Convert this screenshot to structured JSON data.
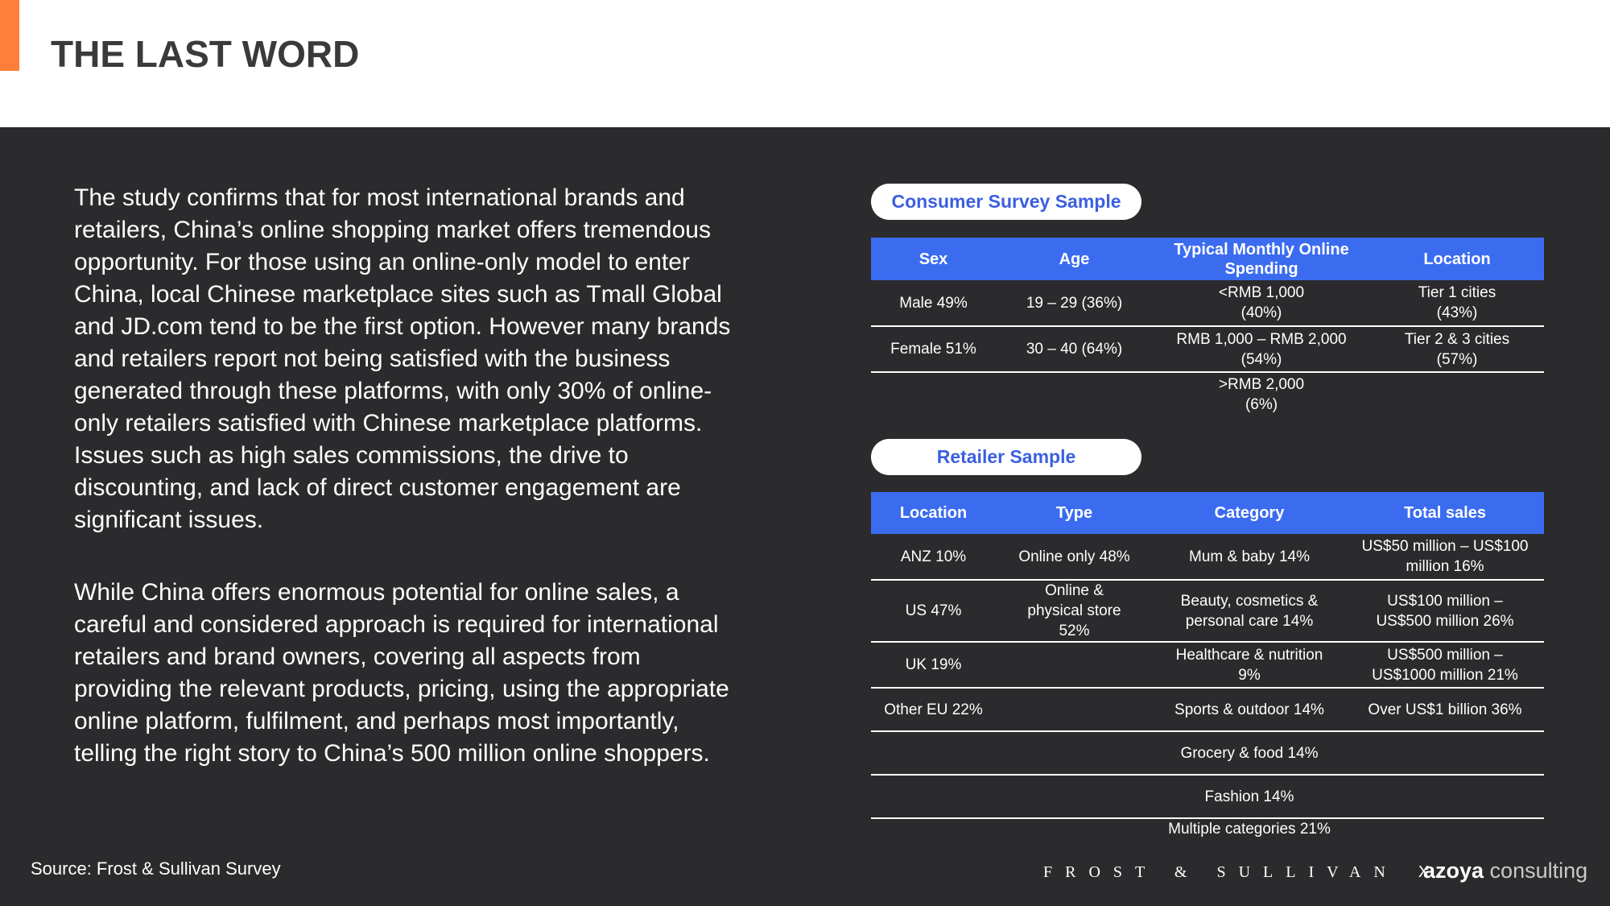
{
  "header": {
    "title": "THE LAST WORD",
    "accent_color": "#ff7f3a"
  },
  "body": {
    "paragraph1": "The study confirms that for most international brands and retailers, China’s online shopping market offers tremendous opportunity. For those using an online-only model to enter China, local Chinese marketplace sites such as Tmall Global and JD.com tend to be the first option. However many brands and retailers report not being satisfied with the business generated through these platforms, with only 30% of online-only retailers satisfied with Chinese marketplace platforms. Issues such as high sales commissions, the drive to discounting, and lack of direct customer engagement are significant issues.",
    "paragraph2": "While China offers enormous potential for online sales, a careful and considered approach is required for international retailers and brand owners, covering all aspects from providing the relevant products, pricing, using the appropriate online platform, fulfilment, and perhaps most importantly, telling the right story to China’s 500 million online shoppers."
  },
  "consumer": {
    "title": "Consumer Survey Sample",
    "headers": [
      "Sex",
      "Age",
      "Typical Monthly Online Spending",
      "Location"
    ],
    "rows": [
      [
        "Male 49%",
        "19 – 29 (36%)",
        "<RMB 1,000\n(40%)",
        "Tier 1 cities\n(43%)"
      ],
      [
        "Female 51%",
        "30 – 40 (64%)",
        "RMB 1,000 – RMB 2,000\n(54%)",
        "Tier 2 & 3 cities\n(57%)"
      ],
      [
        "",
        "",
        ">RMB 2,000\n(6%)",
        ""
      ]
    ]
  },
  "retailer": {
    "title": "Retailer Sample",
    "headers": [
      "Location",
      "Type",
      "Category",
      "Total sales"
    ],
    "rows": [
      [
        "ANZ 10%",
        "Online only 48%",
        "Mum & baby 14%",
        "US$50 million – US$100 million 16%"
      ],
      [
        "US 47%",
        "Online & physical store 52%",
        "Beauty, cosmetics & personal care 14%",
        "US$100 million – US$500 million 26%"
      ],
      [
        "UK 19%",
        "",
        "Healthcare & nutrition 9%",
        "US$500 million – US$1000 million 21%"
      ],
      [
        "Other EU 22%",
        "",
        "Sports & outdoor 14%",
        "Over US$1 billion 36%"
      ],
      [
        "",
        "",
        "Grocery & food 14%",
        ""
      ],
      [
        "",
        "",
        "Fashion 14%",
        ""
      ],
      [
        "",
        "",
        "Multiple categories 21%",
        ""
      ]
    ]
  },
  "footer": {
    "source": "Source: Frost & Sullivan Survey",
    "logo_frost": "FROST & SULLIVAN",
    "logo_x": "X",
    "logo_azoya_bold": "azoya",
    "logo_azoya_light": " consulting"
  },
  "colors": {
    "table_header": "#3b6cf0",
    "pill_text": "#3b5fe0",
    "background": "#2b2b2d"
  }
}
